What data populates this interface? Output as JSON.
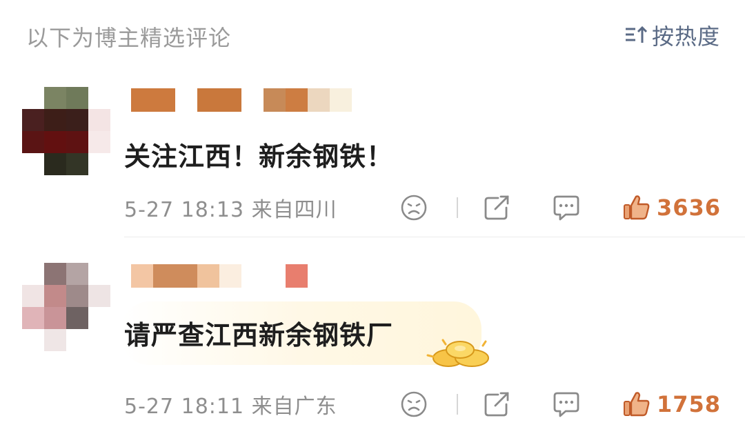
{
  "header": {
    "title": "以下为博主精选评论",
    "sort_label": "按热度"
  },
  "comments": [
    {
      "text": "关注江西！新余钢铁！",
      "time": "5-27 18:13",
      "location": "来自四川",
      "likes": "3636",
      "icons": [
        "dislike-face-icon",
        "share-icon",
        "reply-icon",
        "thumbs-up-icon"
      ]
    },
    {
      "text": "请严查江西新余钢铁厂",
      "time": "5-27 18:11",
      "location": "来自广东",
      "likes": "1758",
      "icons": [
        "dislike-face-icon",
        "share-icon",
        "reply-icon",
        "thumbs-up-icon",
        "gold-coins-icon"
      ]
    }
  ],
  "colors": {
    "accent_like": "#d1723a",
    "sort_label": "#5a6a85",
    "muted": "#8e8e8e"
  }
}
